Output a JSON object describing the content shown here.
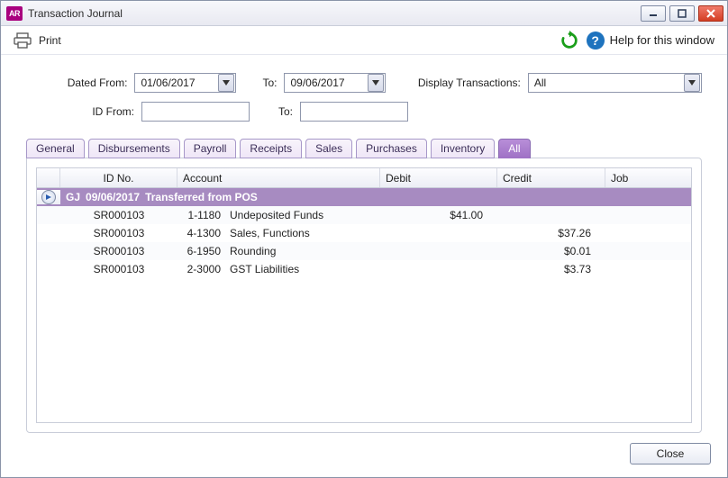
{
  "titlebar": {
    "app_badge": "AR",
    "title": "Transaction Journal"
  },
  "toolbar": {
    "print": "Print",
    "help": "Help for this window"
  },
  "filters": {
    "dated_from_label": "Dated From:",
    "dated_from_value": "01/06/2017",
    "dated_to_label": "To:",
    "dated_to_value": "09/06/2017",
    "display_label": "Display Transactions:",
    "display_value": "All",
    "id_from_label": "ID From:",
    "id_from_value": "",
    "id_to_label": "To:",
    "id_to_value": ""
  },
  "tabs": {
    "general": "General",
    "disbursements": "Disbursements",
    "payroll": "Payroll",
    "receipts": "Receipts",
    "sales": "Sales",
    "purchases": "Purchases",
    "inventory": "Inventory",
    "all": "All"
  },
  "columns": {
    "id": "ID No.",
    "account": "Account",
    "debit": "Debit",
    "credit": "Credit",
    "job": "Job"
  },
  "group": {
    "code": "GJ",
    "date": "09/06/2017",
    "desc": "Transferred from POS"
  },
  "rows": [
    {
      "id": "SR000103",
      "acct_code": "1-1180",
      "acct_name": "Undeposited Funds",
      "debit": "$41.00",
      "credit": "",
      "job": ""
    },
    {
      "id": "SR000103",
      "acct_code": "4-1300",
      "acct_name": "Sales, Functions",
      "debit": "",
      "credit": "$37.26",
      "job": ""
    },
    {
      "id": "SR000103",
      "acct_code": "6-1950",
      "acct_name": "Rounding",
      "debit": "",
      "credit": "$0.01",
      "job": ""
    },
    {
      "id": "SR000103",
      "acct_code": "2-3000",
      "acct_name": "GST Liabilities",
      "debit": "",
      "credit": "$3.73",
      "job": ""
    }
  ],
  "footer": {
    "close": "Close"
  }
}
